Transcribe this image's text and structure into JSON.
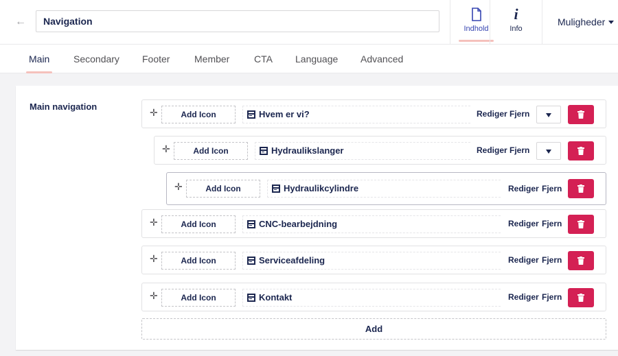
{
  "header": {
    "title_value": "Navigation",
    "apps": [
      {
        "label": "Indhold",
        "icon": "document-icon",
        "active": true
      },
      {
        "label": "Info",
        "icon": "info-icon",
        "active": false
      }
    ],
    "options_label": "Muligheder"
  },
  "tabs": [
    "Main",
    "Secondary",
    "Footer",
    "Member",
    "CTA",
    "Language",
    "Advanced"
  ],
  "active_tab": "Main",
  "panel": {
    "label": "Main navigation",
    "add_label": "Add",
    "colors": {
      "delete": "#d42054",
      "tab_indicator": "#f5c1bc",
      "text": "#1b264f"
    },
    "items": [
      {
        "add_icon": "Add Icon",
        "name": "Hvem er vi?",
        "edit": "Rediger",
        "remove": "Fjern",
        "has_dropdown": true,
        "level": 0
      },
      {
        "add_icon": "Add Icon",
        "name": "Hydraulikslanger",
        "edit": "Rediger",
        "remove": "Fjern",
        "has_dropdown": true,
        "level": 1
      },
      {
        "add_icon": "Add Icon",
        "name": "Hydraulikcylindre",
        "edit": "Rediger",
        "remove": "Fjern",
        "has_dropdown": false,
        "level": 2
      },
      {
        "add_icon": "Add Icon",
        "name": "CNC-bearbejdning",
        "edit": "Rediger",
        "remove": "Fjern",
        "has_dropdown": false,
        "level": 0
      },
      {
        "add_icon": "Add Icon",
        "name": "Serviceafdeling",
        "edit": "Rediger",
        "remove": "Fjern",
        "has_dropdown": false,
        "level": 0
      },
      {
        "add_icon": "Add Icon",
        "name": "Kontakt",
        "edit": "Rediger",
        "remove": "Fjern",
        "has_dropdown": false,
        "level": 0
      }
    ]
  }
}
